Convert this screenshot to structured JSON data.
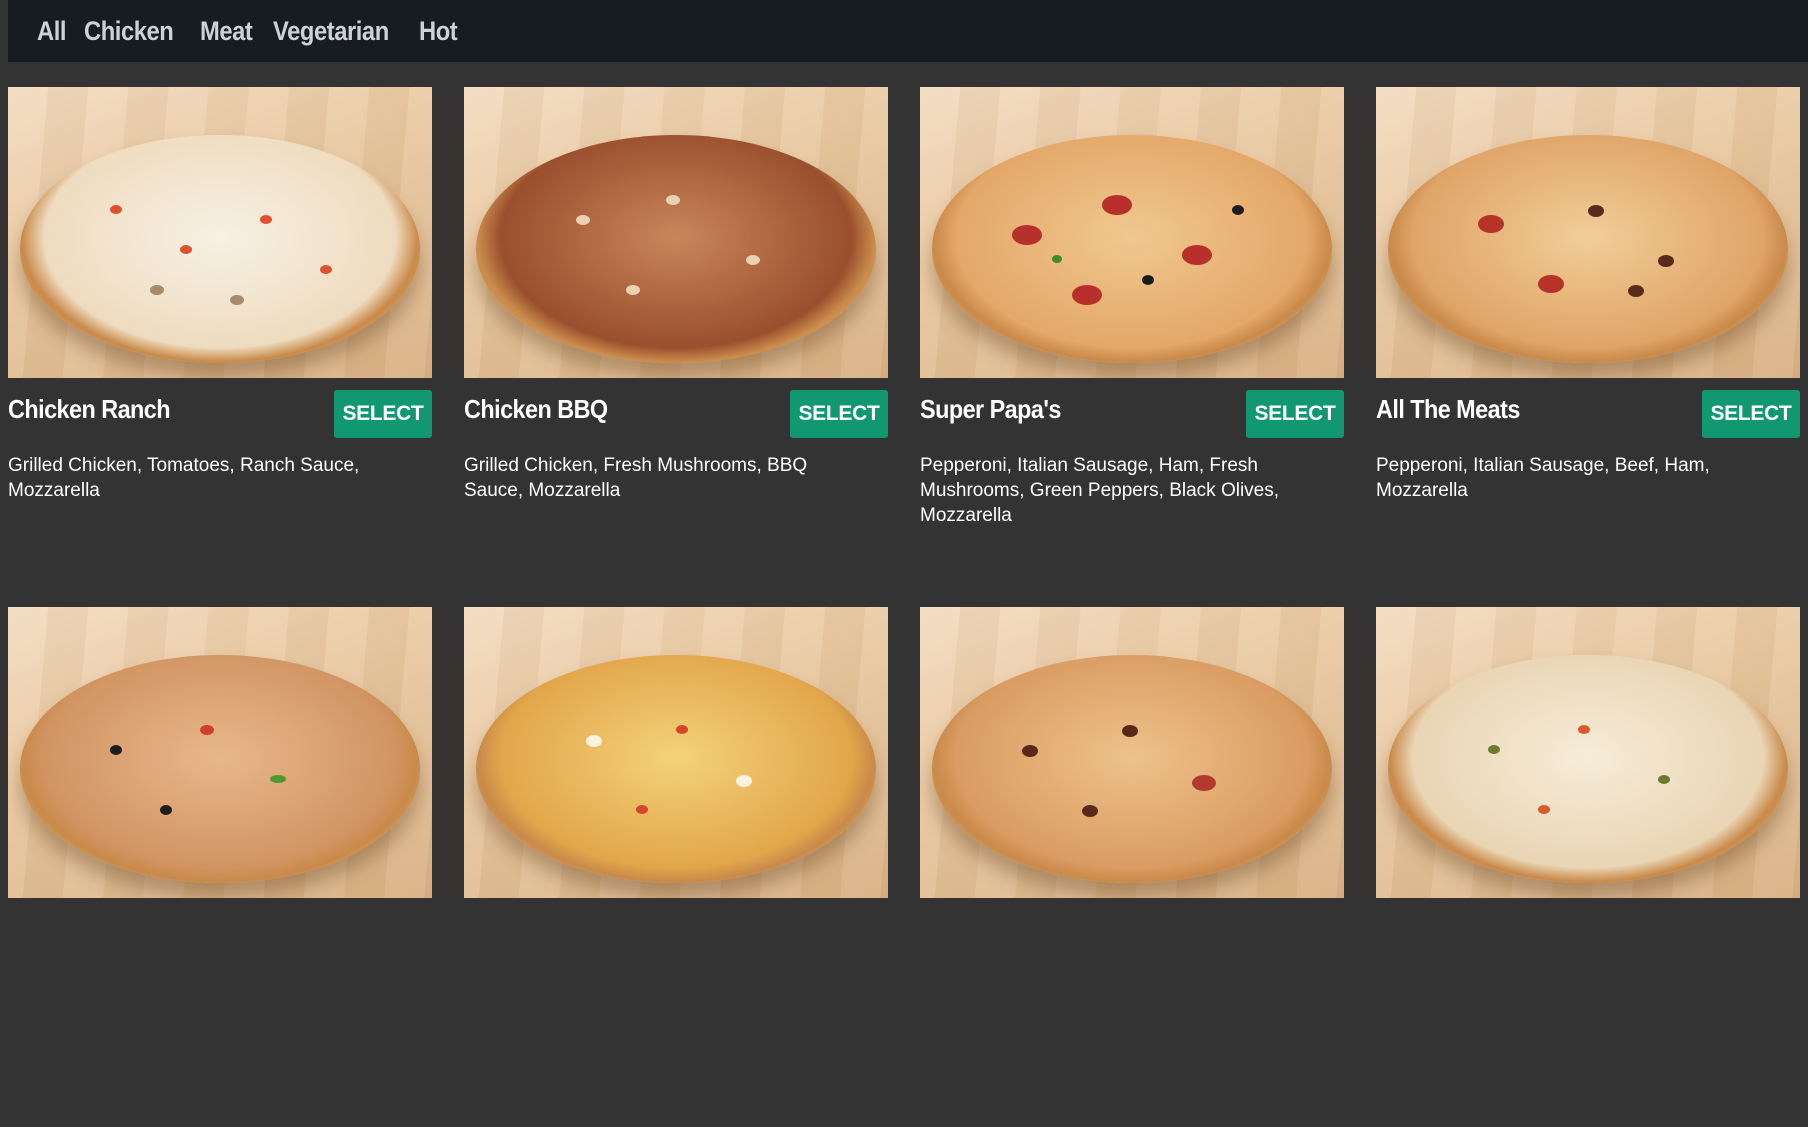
{
  "nav": {
    "items": [
      "All",
      "Chicken",
      "Meat",
      "Vegetarian",
      "Hot"
    ]
  },
  "select_label": "SELECT",
  "products": [
    {
      "name": "Chicken Ranch",
      "description": "Grilled Chicken, Tomatoes, Ranch Sauce, Mozzarella"
    },
    {
      "name": "Chicken BBQ",
      "description": "Grilled Chicken, Fresh Mushrooms, BBQ Sauce, Mozzarella"
    },
    {
      "name": "Super Papa's",
      "description": "Pepperoni, Italian Sausage, Ham, Fresh Mushrooms, Green Peppers, Black Olives, Mozzarella"
    },
    {
      "name": "All The Meats",
      "description": "Pepperoni, Italian Sausage, Beef, Ham, Mozzarella"
    },
    {
      "name": "",
      "description": ""
    },
    {
      "name": "",
      "description": ""
    },
    {
      "name": "",
      "description": ""
    },
    {
      "name": "",
      "description": ""
    }
  ],
  "colors": {
    "background": "#333334",
    "nav_background": "#171c22",
    "nav_text": "#cfd2d4",
    "select_button": "#129871"
  }
}
